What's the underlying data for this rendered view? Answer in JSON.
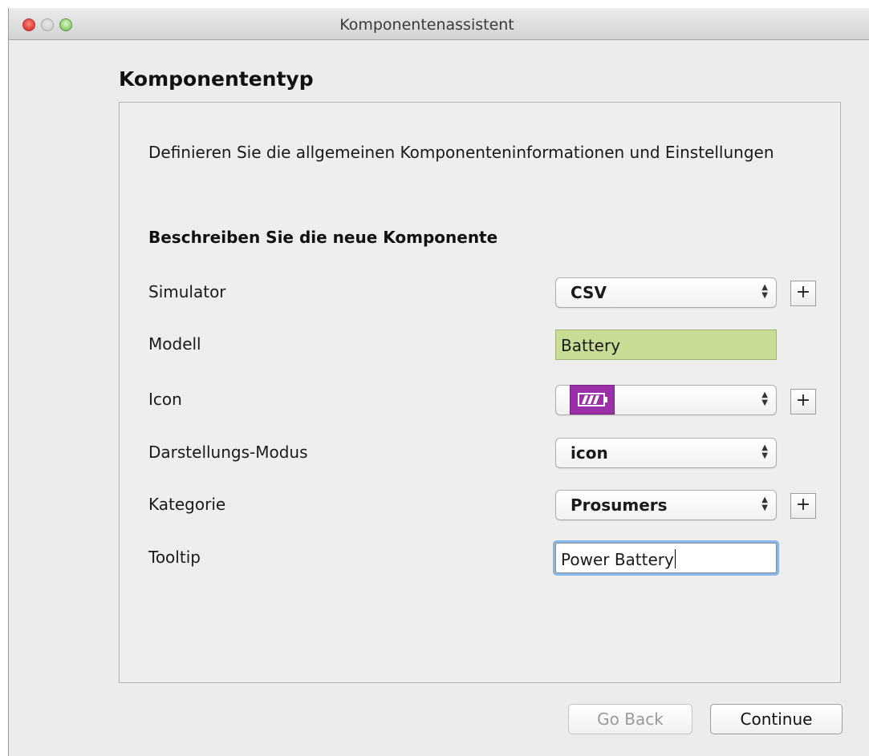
{
  "window": {
    "title": "Komponentenassistent"
  },
  "page": {
    "heading": "Komponententyp",
    "description": "Definieren Sie die allgemeinen Komponenteninformationen und Einstellungen",
    "section_title": "Beschreiben Sie die neue Komponente"
  },
  "form": {
    "simulator": {
      "label": "Simulator",
      "value": "CSV"
    },
    "model": {
      "label": "Modell",
      "value": "Battery"
    },
    "icon": {
      "label": "Icon",
      "value_icon": "battery-icon",
      "icon_color": "#9a2fa8"
    },
    "display_mode": {
      "label": "Darstellungs-Modus",
      "value": "icon"
    },
    "category": {
      "label": "Kategorie",
      "value": "Prosumers"
    },
    "tooltip": {
      "label": "Tooltip",
      "value": "Power Battery"
    },
    "add_label": "+"
  },
  "buttons": {
    "back": "Go Back",
    "continue": "Continue"
  }
}
